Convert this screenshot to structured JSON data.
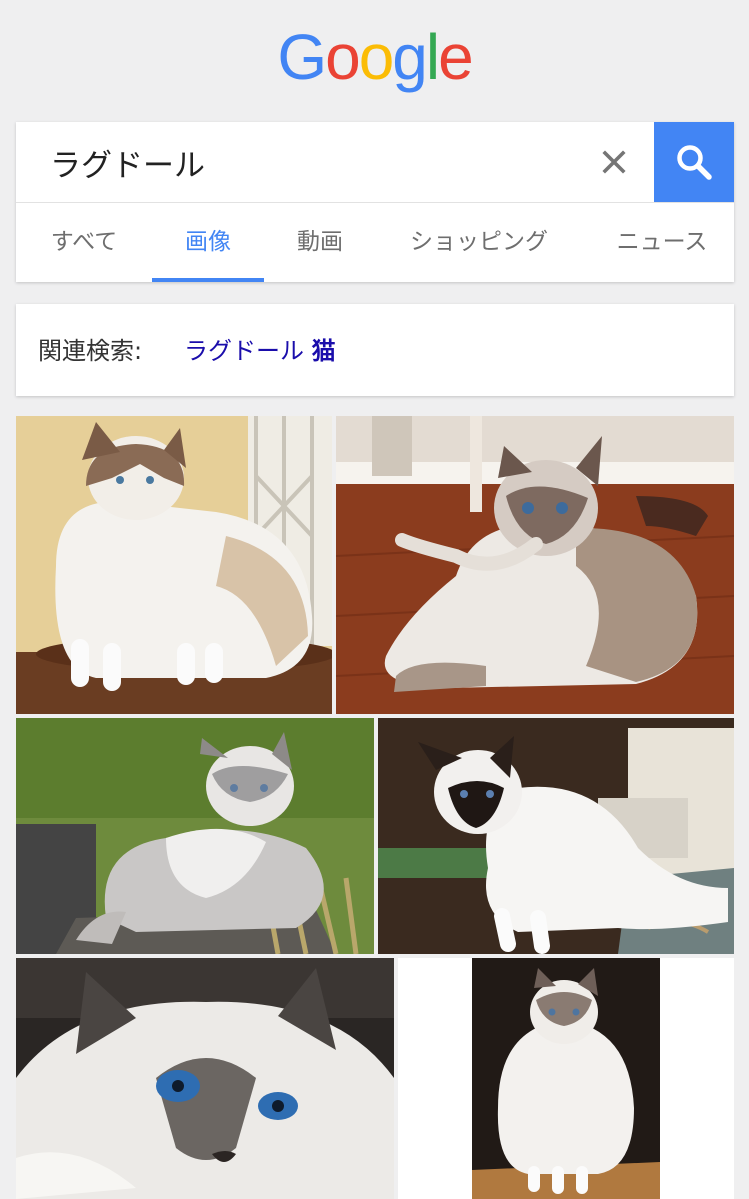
{
  "logo": {
    "letters": [
      "G",
      "o",
      "o",
      "g",
      "l",
      "e"
    ],
    "colors": [
      "#4285f4",
      "#ea4335",
      "#fbbc05",
      "#4285f4",
      "#34a853",
      "#ea4335"
    ]
  },
  "search": {
    "query": "ラグドール",
    "placeholder": ""
  },
  "tabs": [
    {
      "label": "すべて",
      "active": false
    },
    {
      "label": "画像",
      "active": true
    },
    {
      "label": "動画",
      "active": false
    },
    {
      "label": "ショッピング",
      "active": false
    },
    {
      "label": "ニュース",
      "active": false
    }
  ],
  "related": {
    "label": "関連検索:",
    "link_text": "ラグドール",
    "link_bold": "猫"
  },
  "images": [
    {
      "subject": "ragdoll-cat-standing-wooden-table"
    },
    {
      "subject": "ragdoll-cat-lying-wood-floor"
    },
    {
      "subject": "gray-white-cat-sitting-on-grass"
    },
    {
      "subject": "siamese-colored-kitten-sitting"
    },
    {
      "subject": "blue-eyed-cat-face-closeup"
    },
    {
      "subject": "ragdoll-cat-sitting-on-box"
    }
  ],
  "colors": {
    "accent": "#4285f4",
    "link": "#1a0dab",
    "background": "#efeff0"
  },
  "icons": {
    "clear": "close-icon",
    "search": "search-icon"
  }
}
